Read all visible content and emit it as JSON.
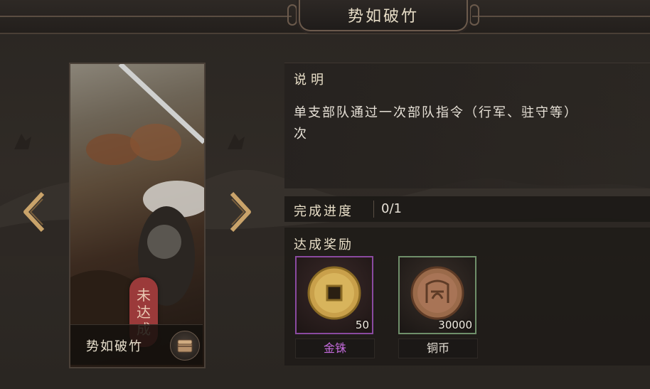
{
  "header": {
    "title": "势如破竹"
  },
  "card": {
    "name": "势如破竹",
    "status_seal": [
      "未",
      "达",
      "成"
    ]
  },
  "description": {
    "title": "说明",
    "text_line1": "单支部队通过一次部队指令（行军、驻守等）",
    "text_line2": "次"
  },
  "progress": {
    "label": "完成进度",
    "value": "0/1"
  },
  "rewards": {
    "title": "达成奖励",
    "items": [
      {
        "name": "金铢",
        "count": "50",
        "icon": "gold-coin-icon",
        "frame_color": "#8a4aa0",
        "label_color": "#c46bdc"
      },
      {
        "name": "铜币",
        "count": "30000",
        "icon": "copper-coin-icon",
        "frame_color": "#6f8f6a",
        "label_color": "#e6e0d6"
      }
    ]
  },
  "navigation": {
    "prev_icon": "chevron-left-icon",
    "next_icon": "chevron-right-icon"
  },
  "colors": {
    "accent_gold": "#c9a36a",
    "seal_red": "#9b3a3a"
  }
}
